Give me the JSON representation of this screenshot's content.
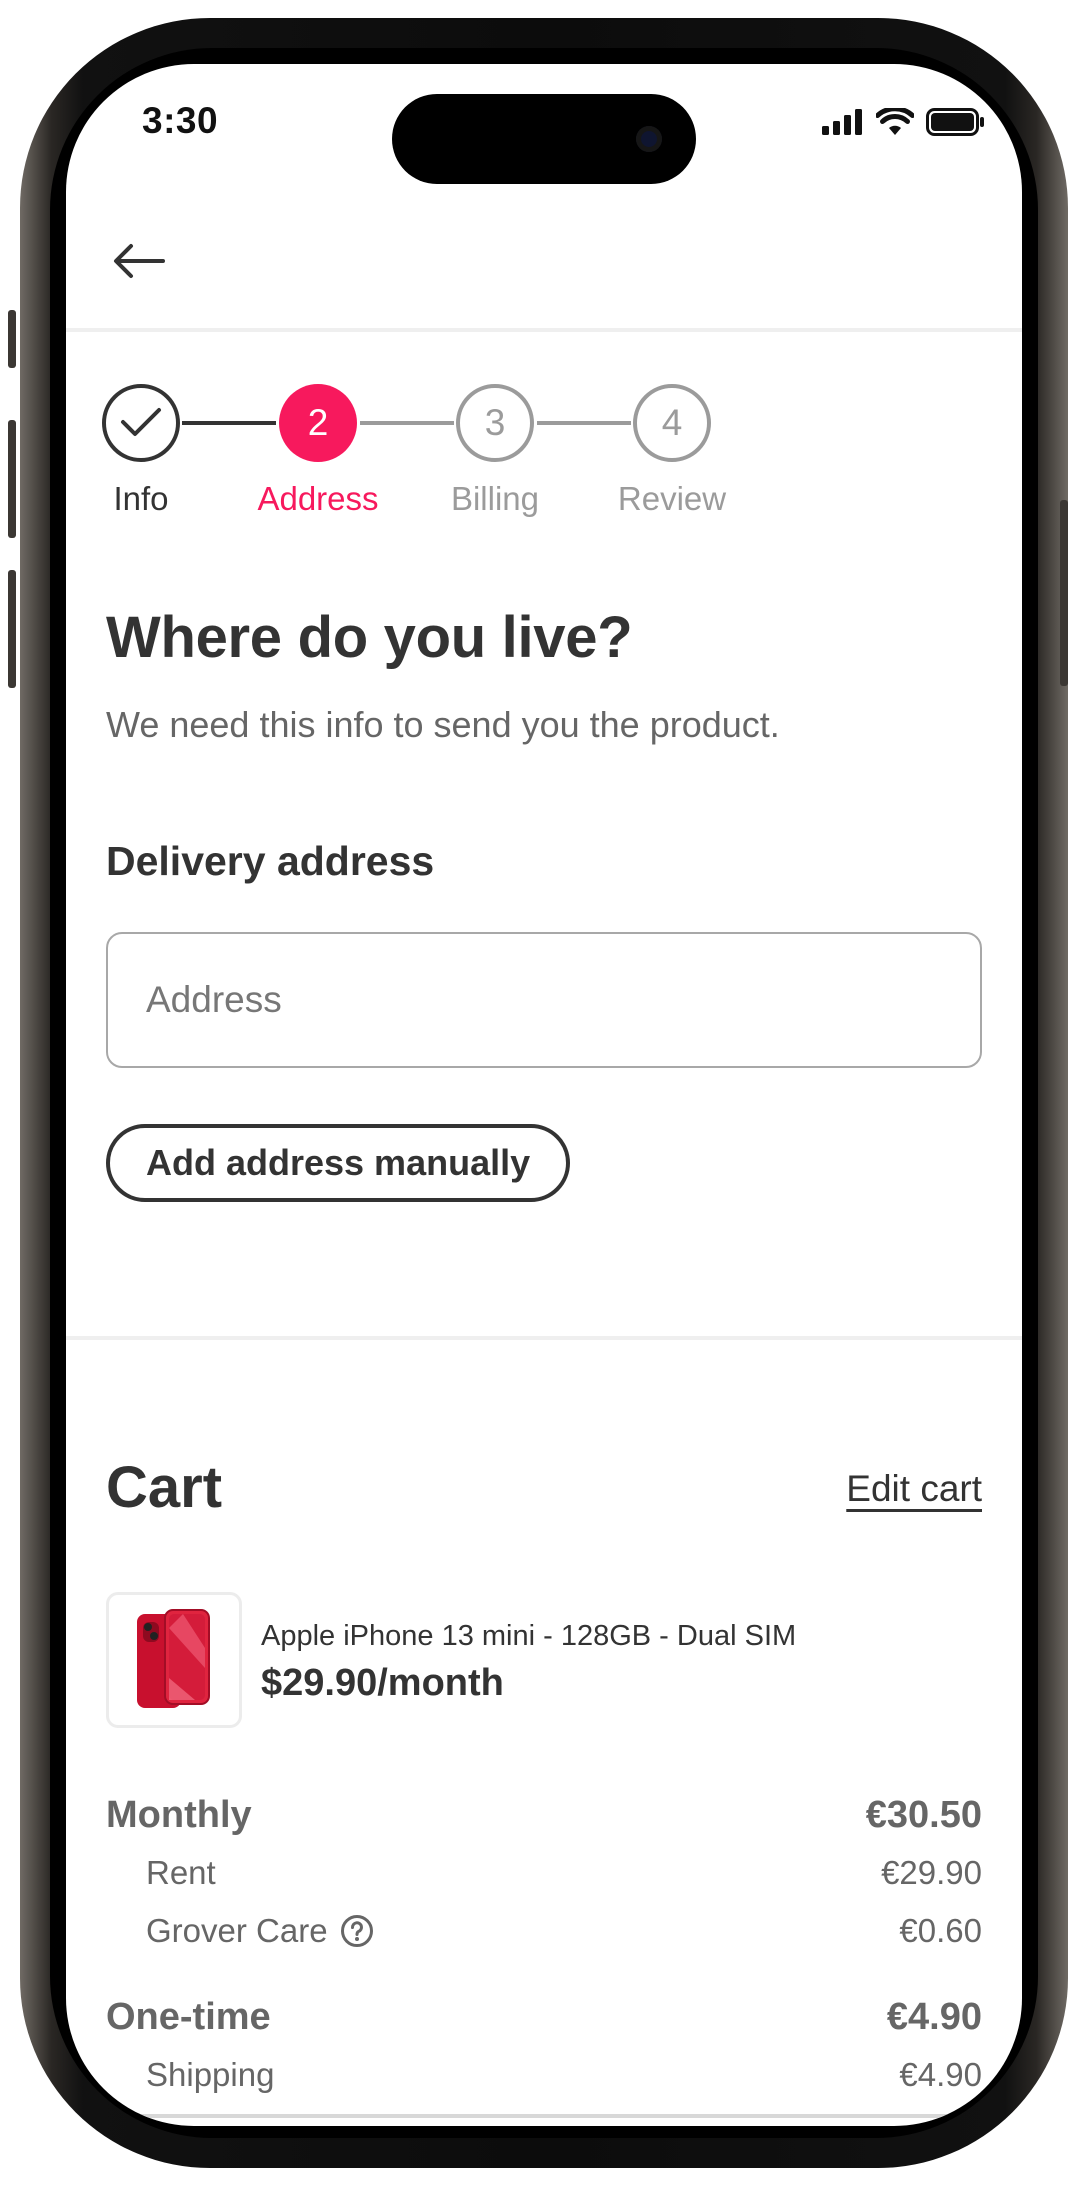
{
  "status_bar": {
    "time": "3:30"
  },
  "stepper": {
    "steps": [
      {
        "number": "",
        "label": "Info",
        "state": "done"
      },
      {
        "number": "2",
        "label": "Address",
        "state": "active"
      },
      {
        "number": "3",
        "label": "Billing",
        "state": "todo"
      },
      {
        "number": "4",
        "label": "Review",
        "state": "todo"
      }
    ]
  },
  "address_form": {
    "heading": "Where do you live?",
    "subtext": "We need this info to send you the product.",
    "section_label": "Delivery address",
    "input_placeholder": "Address",
    "input_value": "",
    "manual_button_label": "Add address manually"
  },
  "cart": {
    "title": "Cart",
    "edit_link": "Edit cart",
    "product": {
      "name": "Apple iPhone 13 mini - 128GB - Dual SIM",
      "price": "$29.90/month"
    },
    "monthly": {
      "label": "Monthly",
      "total": "€30.50",
      "items": [
        {
          "label": "Rent",
          "value": "€29.90"
        },
        {
          "label": "Grover Care",
          "value": "€0.60"
        }
      ]
    },
    "one_time": {
      "label": "One-time",
      "total": "€4.90",
      "items": [
        {
          "label": "Shipping",
          "value": "€4.90"
        }
      ]
    }
  },
  "colors": {
    "accent": "#f7195d",
    "text_primary": "#333333",
    "text_secondary": "#666666",
    "inactive": "#9b9b9b"
  },
  "icons": [
    "back-arrow-icon",
    "checkmark-icon",
    "signal-icon",
    "wifi-icon",
    "battery-icon",
    "help-circle-icon"
  ]
}
